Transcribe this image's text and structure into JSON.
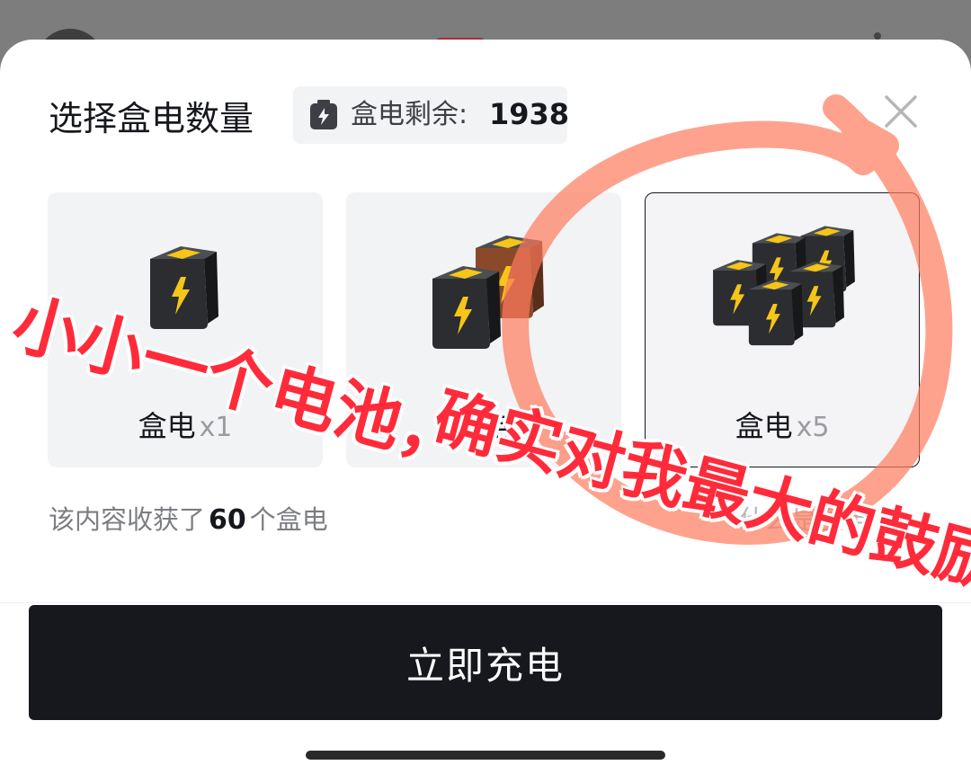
{
  "sheet": {
    "title": "选择盒电数量",
    "balance": {
      "label": "盒电剩余:",
      "value": "1938"
    },
    "cards": [
      {
        "name": "盒电",
        "qty": "x1",
        "selected": false
      },
      {
        "name": "盒电",
        "qty": "",
        "selected": false
      },
      {
        "name": "盒电",
        "qty": "x5",
        "selected": true
      }
    ],
    "received": {
      "prefix": "该内容收获了",
      "count": "60",
      "suffix": "个盒电"
    },
    "help_link": "什么是盒电",
    "charge_button": "立即充电"
  },
  "overlay_text": {
    "line1": "小小一个电池，",
    "line2": "确实对我最大的鼓励"
  },
  "colors": {
    "primary": "#16181d",
    "card_bg": "#f2f3f5",
    "battery_yellow": "#f5c518",
    "annotation_red": "#ff2b3a",
    "circle": "#ff7a5c"
  }
}
